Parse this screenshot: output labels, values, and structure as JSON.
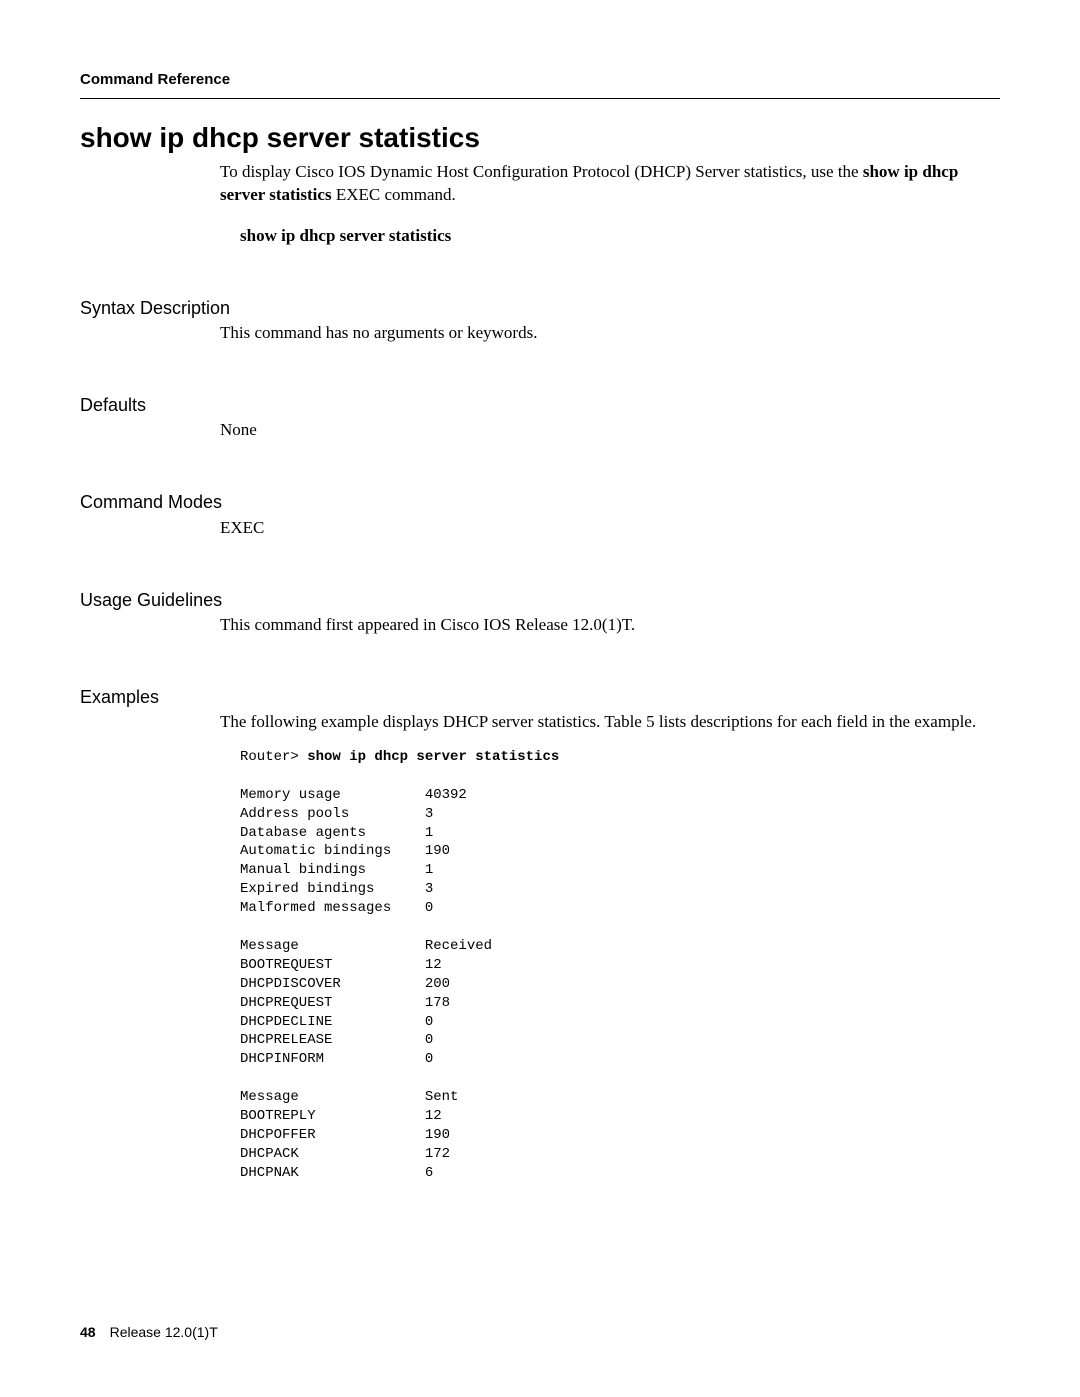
{
  "header": "Command Reference",
  "title": "show ip dhcp server statistics",
  "intro_pre": "To display Cisco IOS Dynamic Host Configuration Protocol (DHCP) Server statistics, use the ",
  "intro_cmd": "show ip dhcp server statistics",
  "intro_post": " EXEC command.",
  "syntax_line": "show ip dhcp server statistics",
  "sections": {
    "syntax_desc": {
      "head": "Syntax Description",
      "body": "This command has no arguments or keywords."
    },
    "defaults": {
      "head": "Defaults",
      "body": "None"
    },
    "modes": {
      "head": "Command Modes",
      "body": "EXEC"
    },
    "usage": {
      "head": "Usage Guidelines",
      "body": "This command first appeared in Cisco IOS Release 12.0(1)T."
    },
    "examples": {
      "head": "Examples",
      "body": "The following example displays DHCP server statistics. Table 5 lists descriptions for each field in the example."
    }
  },
  "cli": {
    "prompt": "Router> ",
    "command": "show ip dhcp server statistics",
    "stats": [
      [
        "Memory usage",
        "40392"
      ],
      [
        "Address pools",
        "3"
      ],
      [
        "Database agents",
        "1"
      ],
      [
        "Automatic bindings",
        "190"
      ],
      [
        "Manual bindings",
        "1"
      ],
      [
        "Expired bindings",
        "3"
      ],
      [
        "Malformed messages",
        "0"
      ]
    ],
    "received_header": [
      "Message",
      "Received"
    ],
    "received": [
      [
        "BOOTREQUEST",
        "12"
      ],
      [
        "DHCPDISCOVER",
        "200"
      ],
      [
        "DHCPREQUEST",
        "178"
      ],
      [
        "DHCPDECLINE",
        "0"
      ],
      [
        "DHCPRELEASE",
        "0"
      ],
      [
        "DHCPINFORM",
        "0"
      ]
    ],
    "sent_header": [
      "Message",
      "Sent"
    ],
    "sent": [
      [
        "BOOTREPLY",
        "12"
      ],
      [
        "DHCPOFFER",
        "190"
      ],
      [
        "DHCPACK",
        "172"
      ],
      [
        "DHCPNAK",
        "6"
      ]
    ]
  },
  "footer": {
    "page": "48",
    "release": "Release 12.0(1)T"
  }
}
